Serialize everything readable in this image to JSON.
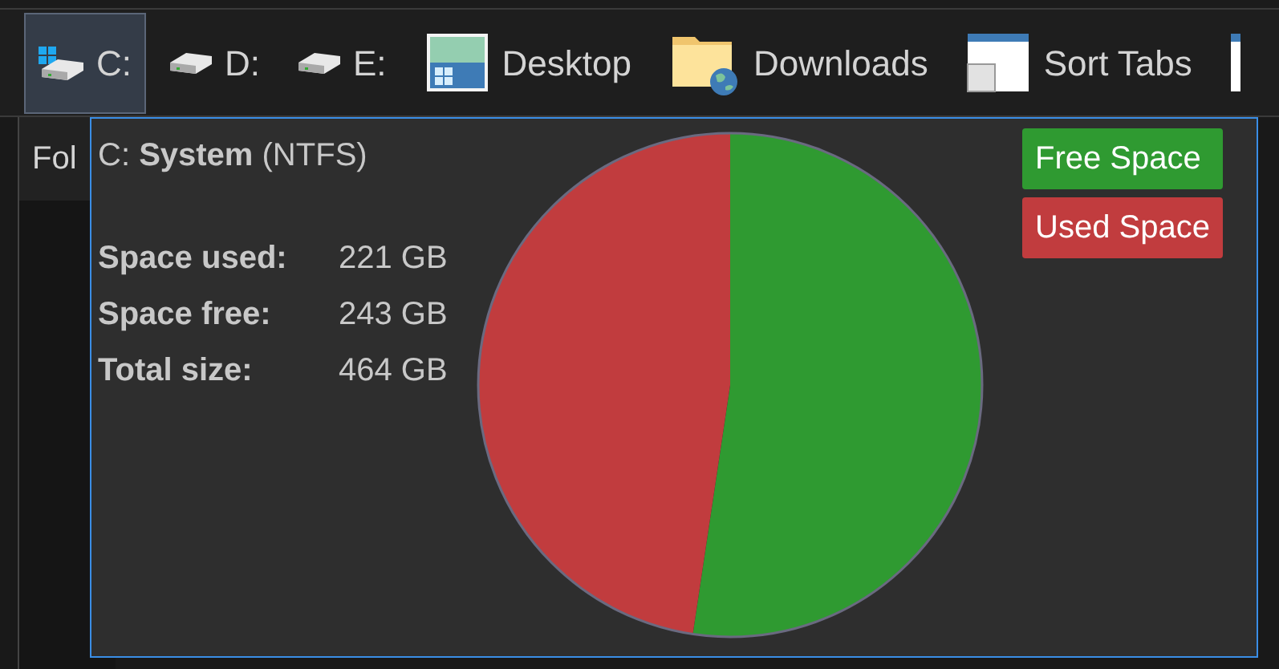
{
  "toolbar": {
    "items": [
      {
        "kind": "system-drive",
        "label": "C:",
        "selected": true
      },
      {
        "kind": "drive",
        "label": "D:",
        "selected": false
      },
      {
        "kind": "drive",
        "label": "E:",
        "selected": false
      },
      {
        "kind": "desktop",
        "label": "Desktop",
        "selected": false
      },
      {
        "kind": "downloads",
        "label": "Downloads",
        "selected": false
      },
      {
        "kind": "sort-tabs",
        "label": "Sort Tabs",
        "selected": false
      },
      {
        "kind": "window",
        "selected": false
      }
    ]
  },
  "folder_pane": {
    "header": "Fol"
  },
  "tooltip": {
    "title": "C: **System** (NTFS)",
    "stats": [
      {
        "label": "Space used:",
        "value": "221 GB"
      },
      {
        "label": "Space free:",
        "value": "243 GB"
      },
      {
        "label": "Total size:",
        "value": "464 GB"
      }
    ],
    "legend": [
      {
        "color": "#2f9a31"
      },
      {
        "color": "#c13c3e"
      }
    ],
    "chart_data": {
      "type": "pie",
      "categories": [
        "Free Space",
        "Used Space"
      ],
      "values": [
        52.37,
        47.63
      ]
    }
  }
}
